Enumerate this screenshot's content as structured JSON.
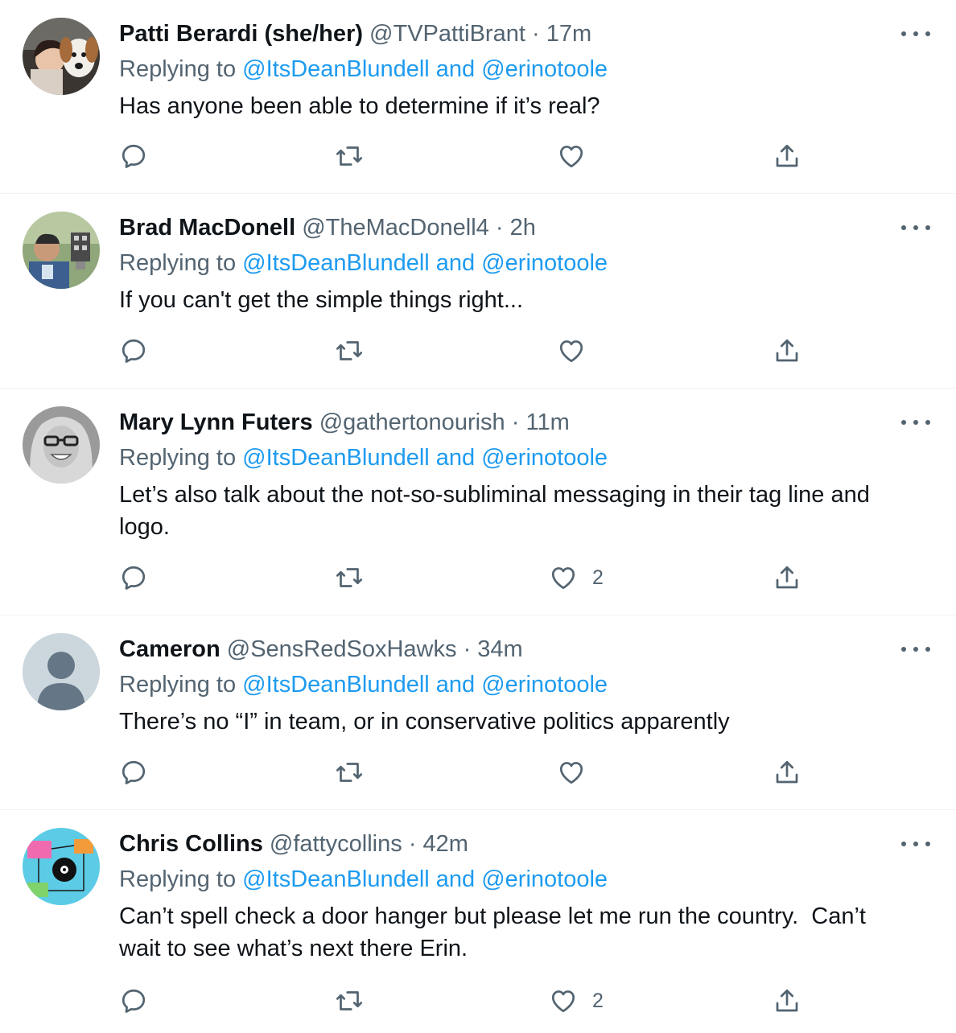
{
  "colors": {
    "accent": "#1d9bf0",
    "muted": "#536471",
    "text": "#0f1419",
    "divider": "#eff3f4"
  },
  "icons": {
    "reply": "speech-bubble-icon",
    "retweet": "retweet-arrows-icon",
    "like": "heart-icon",
    "share": "upload-share-icon",
    "more": "three-dots-icon"
  },
  "tweets": [
    {
      "name": "Patti Berardi (she/her)",
      "handle": "@TVPattiBrant",
      "separator": "·",
      "time": "17m",
      "replying_prefix": "Replying to ",
      "mention1": "@ItsDeanBlundell",
      "mention_joiner": " and ",
      "mention2": "@erinotoole",
      "text_lines": [
        "Has anyone been able to determine if it’s real?"
      ],
      "likes": ""
    },
    {
      "name": "Brad MacDonell",
      "handle": "@TheMacDonell4",
      "separator": "·",
      "time": "2h",
      "replying_prefix": "Replying to ",
      "mention1": "@ItsDeanBlundell",
      "mention_joiner": " and ",
      "mention2": "@erinotoole",
      "text_lines": [
        "If you can't get the simple things right..."
      ],
      "likes": ""
    },
    {
      "name": "Mary Lynn Futers",
      "handle": "@gathertonourish",
      "separator": "·",
      "time": "11m",
      "replying_prefix": "Replying to ",
      "mention1": "@ItsDeanBlundell",
      "mention_joiner": " and ",
      "mention2": "@erinotoole",
      "text_lines": [
        "Let’s also talk about the not-so-subliminal messaging in their tag line and",
        "logo."
      ],
      "likes": "2"
    },
    {
      "name": "Cameron",
      "handle": "@SensRedSoxHawks",
      "separator": "·",
      "time": "34m",
      "replying_prefix": "Replying to ",
      "mention1": "@ItsDeanBlundell",
      "mention_joiner": " and ",
      "mention2": "@erinotoole",
      "text_lines": [
        "There’s no “I” in team, or in conservative politics apparently"
      ],
      "likes": ""
    },
    {
      "name": "Chris Collins",
      "handle": "@fattycollins",
      "separator": "·",
      "time": "42m",
      "replying_prefix": "Replying to ",
      "mention1": "@ItsDeanBlundell",
      "mention_joiner": " and ",
      "mention2": "@erinotoole",
      "text_lines": [
        "Can’t spell check a door hanger but please let me run the country.  Can’t",
        "wait to see what’s next there Erin."
      ],
      "likes": "2"
    }
  ]
}
